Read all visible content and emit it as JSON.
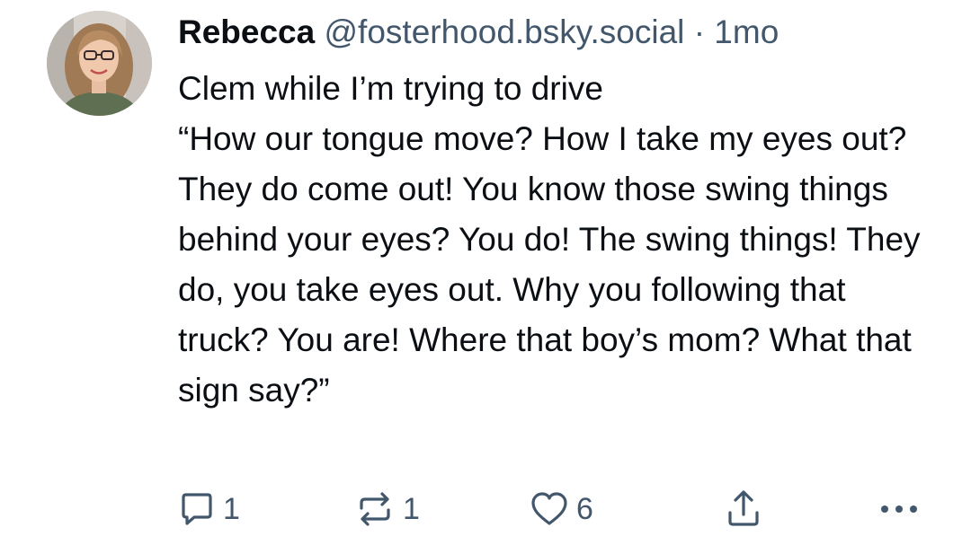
{
  "post": {
    "author_name": "Rebecca",
    "author_handle": "@fosterhood.bsky.social",
    "separator": "·",
    "timestamp": "1mo",
    "text": "Clem while I’m trying to drive\n“How our tongue move? How I take my eyes out? They do come out! You know those swing things behind your eyes? You do! The swing things! They do, you take eyes out. Why you following that truck? You are! Where that boy’s mom? What that sign say?”"
  },
  "actions": {
    "reply_count": "1",
    "repost_count": "1",
    "like_count": "6",
    "icons": {
      "reply": "comment-bubble-icon",
      "repost": "repost-arrows-icon",
      "like": "heart-icon",
      "share": "share-upload-icon",
      "more": "more-dots-icon"
    }
  },
  "colors": {
    "text_primary": "#0b0f14",
    "text_secondary": "#42576c",
    "background": "#ffffff"
  }
}
